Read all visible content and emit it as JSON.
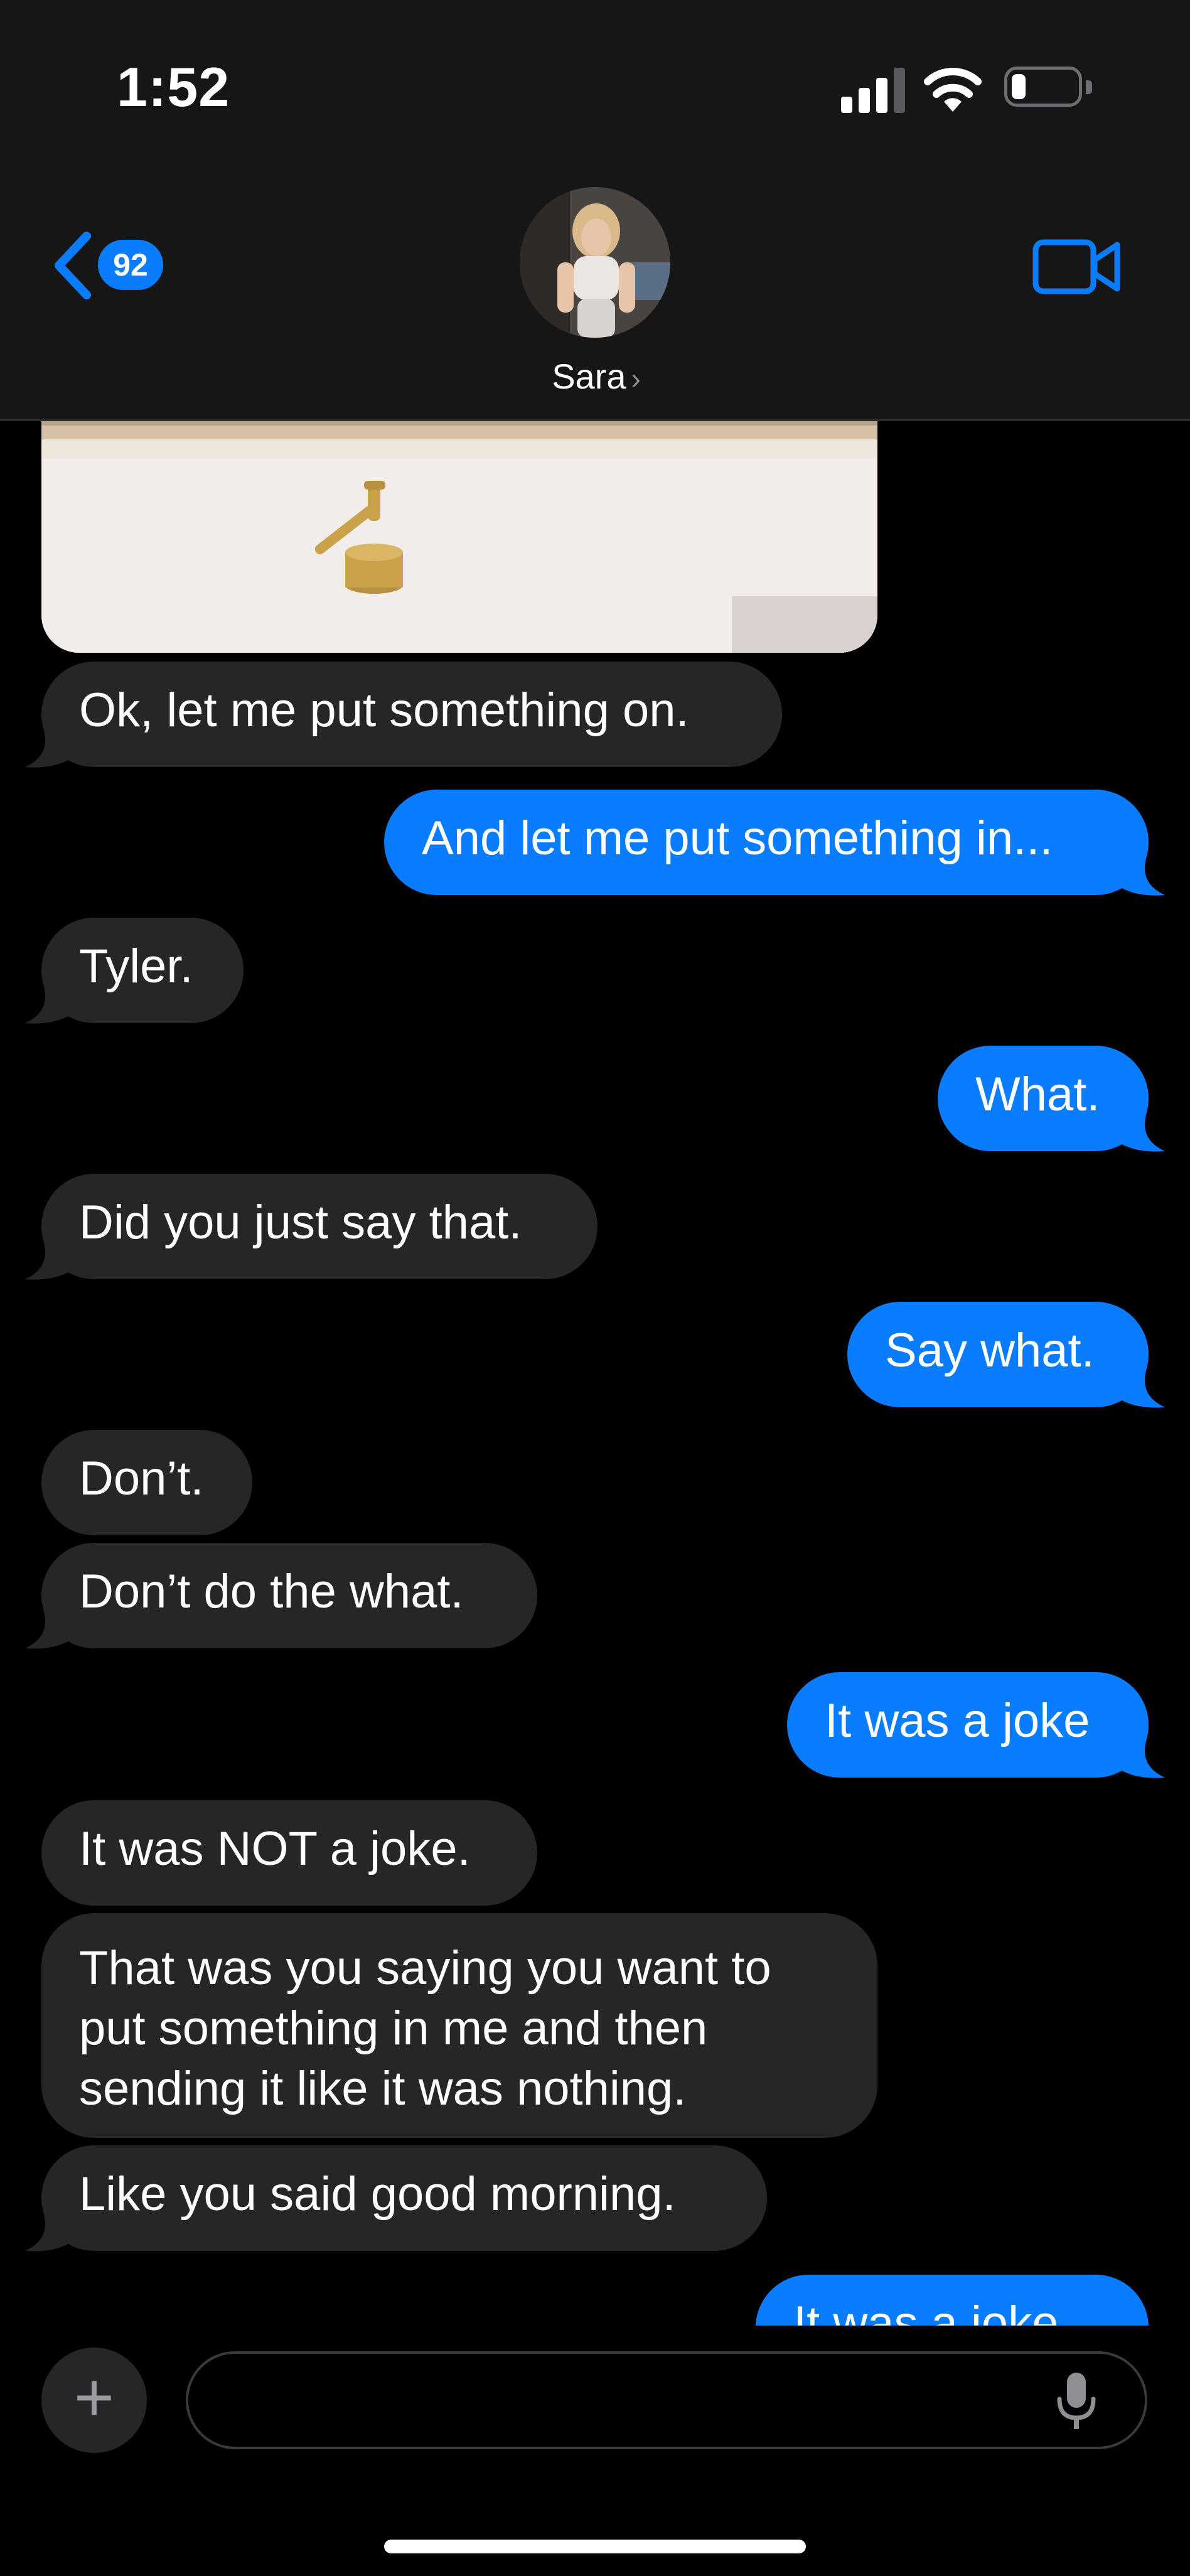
{
  "status_bar": {
    "time": "1:52"
  },
  "header": {
    "back_count": "92",
    "contact_name": "Sara"
  },
  "colors": {
    "accent": "#0a7cff",
    "incoming_bubble": "#262628",
    "header_bg": "#161616"
  },
  "messages": [
    {
      "from": "them",
      "text": "Ok, let me put something on."
    },
    {
      "from": "me",
      "text": "And let me put something in..."
    },
    {
      "from": "them",
      "text": "Tyler."
    },
    {
      "from": "me",
      "text": "What."
    },
    {
      "from": "them",
      "text": "Did you just say that."
    },
    {
      "from": "me",
      "text": "Say what."
    },
    {
      "from": "them",
      "text": "Don’t."
    },
    {
      "from": "them",
      "text": "Don’t do the what."
    },
    {
      "from": "me",
      "text": "It was a joke"
    },
    {
      "from": "them",
      "text": "It was NOT a joke."
    },
    {
      "from": "them",
      "text": "That was you saying you want to put something in me and then sending it like it was nothing."
    },
    {
      "from": "them",
      "text": "Like you said good morning."
    },
    {
      "from": "me",
      "text": "It was a joke"
    }
  ],
  "composer": {
    "value": "",
    "placeholder": ""
  },
  "icons": {
    "back": "chevron-left-icon",
    "video": "video-camera-icon",
    "add": "plus-icon",
    "mic": "microphone-icon"
  }
}
